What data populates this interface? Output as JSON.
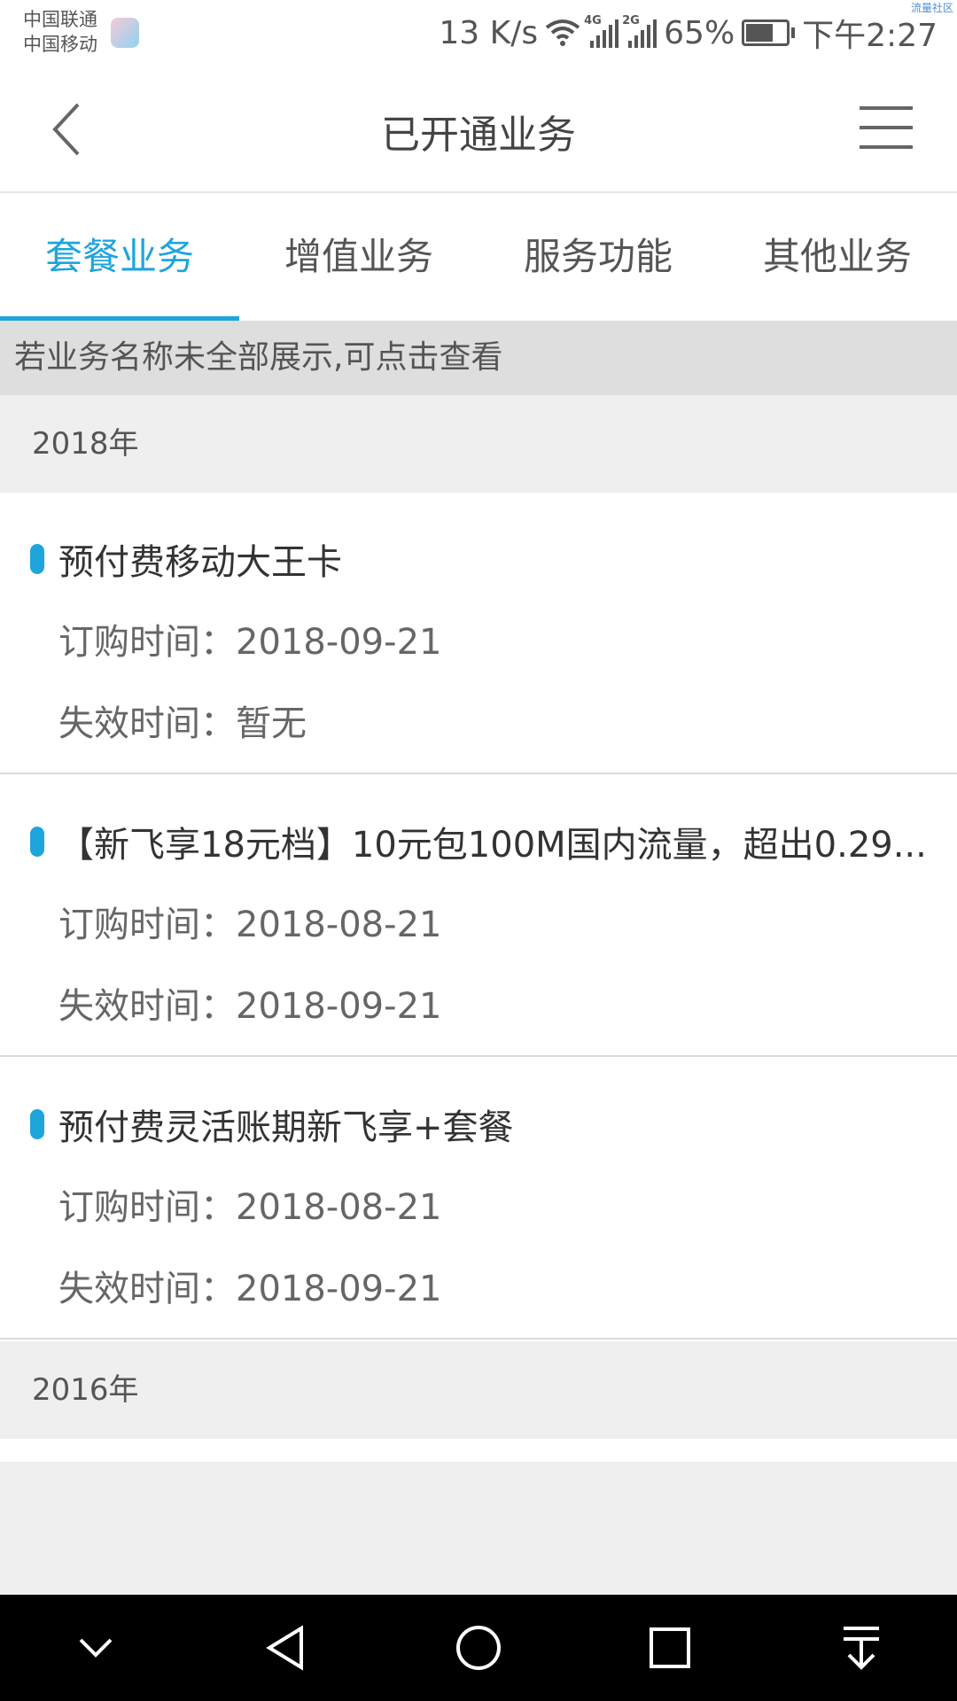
{
  "status_bar": {
    "carrier1": "中国联通",
    "carrier2": "中国移动",
    "watermark": "流量社区",
    "net_speed": "13 K/s",
    "sig1_tag": "4G",
    "sig2_tag": "2G",
    "battery": "65%",
    "time": "下午2:27"
  },
  "header": {
    "title": "已开通业务"
  },
  "tabs": [
    {
      "label": "套餐业务",
      "active": true
    },
    {
      "label": "增值业务",
      "active": false
    },
    {
      "label": "服务功能",
      "active": false
    },
    {
      "label": "其他业务",
      "active": false
    }
  ],
  "notice": "若业务名称未全部展示,可点击查看",
  "years": [
    "2018年",
    "2016年"
  ],
  "items": [
    {
      "name": "预付费移动大王卡",
      "order_label": "订购时间：",
      "order_date": "2018-09-21",
      "expire_label": "失效时间：",
      "expire_date": "暂无"
    },
    {
      "name": "【新飞享18元档】10元包100M国内流量，超出0.29...",
      "order_label": "订购时间：",
      "order_date": "2018-08-21",
      "expire_label": "失效时间：",
      "expire_date": "2018-09-21"
    },
    {
      "name": "预付费灵活账期新飞享+套餐",
      "order_label": "订购时间：",
      "order_date": "2018-08-21",
      "expire_label": "失效时间：",
      "expire_date": "2018-09-21"
    }
  ],
  "accent_color": "#1ea5dc"
}
